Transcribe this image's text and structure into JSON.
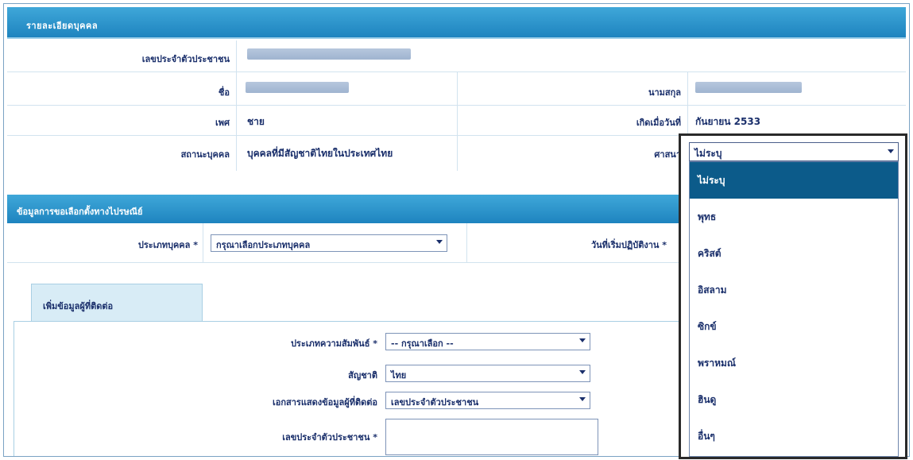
{
  "section1": {
    "title": "รายละเอียดบุคคล",
    "id_label": "เลขประจำตัวประชาชน",
    "name_label": "ชื่อ",
    "surname_label": "นามสกุล",
    "gender_label": "เพศ",
    "gender_value": "ชาย",
    "birth_label": "เกิดเมื่อวันที่",
    "birth_value": "กันยายน 2533",
    "status_label": "สถานะบุคคล",
    "status_value": "บุคคลที่มีสัญชาติไทยในประเทศไทย",
    "religion_label": "ศาสนา"
  },
  "section2": {
    "title": "ข้อมูลการขอเลือกตั้งทางไปรษณีย์",
    "type_label": "ประเภทบุคคล *",
    "type_value": "กรุณาเลือกประเภทบุคคล",
    "date_label": "วันที่เริ่มปฏิบัติงาน *"
  },
  "subsection": {
    "tab_label": "เพิ่มข้อมูลผู้ที่ติดต่อ",
    "relation_label": "ประเภทความสัมพันธ์ *",
    "relation_value": "-- กรุณาเลือก --",
    "nationality_label": "สัญชาติ",
    "nationality_value": "ไทย",
    "doc_label": "เอกสารแสดงข้อมูลผู้ที่ติดต่อ",
    "doc_value": "เลขประจำตัวประชาชน",
    "idno_label": "เลขประจำตัวประชาชน *",
    "idno_value": ""
  },
  "religion_dropdown": {
    "selected": "ไม่ระบุ",
    "options": [
      "ไม่ระบุ",
      "พุทธ",
      "คริสต์",
      "อิสลาม",
      "ซิกข์",
      "พราหมณ์",
      "ฮินดู",
      "อื่นๆ"
    ]
  }
}
